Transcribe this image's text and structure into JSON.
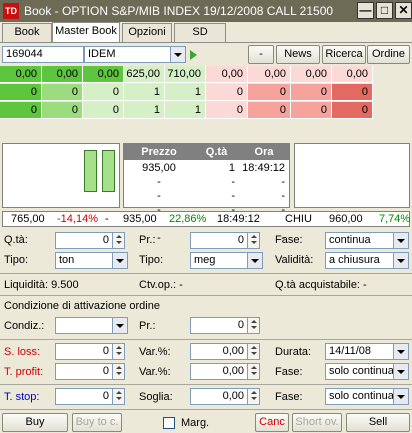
{
  "window": {
    "logo_text": "TD",
    "title": "Book - OPTION S&P/MIB INDEX 19/12/2008 CALL 21500",
    "min_glyph": "—",
    "max_glyph": "□",
    "close_glyph": "✕"
  },
  "tabs": [
    {
      "label": "Book",
      "active": false
    },
    {
      "label": "Master Book",
      "active": true
    },
    {
      "label": "Opzioni",
      "active": false
    },
    {
      "label": "SD",
      "active": false
    }
  ],
  "toolbar": {
    "symbol": "169044",
    "market": "IDEM",
    "minus_label": "-",
    "news_label": "News",
    "ricerca_label": "Ricerca",
    "ordine_label": "Ordine"
  },
  "levels": {
    "row1": [
      "0,00",
      "0,00",
      "0,00",
      "625,00",
      "710,00",
      "0,00",
      "0,00",
      "0,00",
      "0,00"
    ],
    "row2": [
      "0",
      "0",
      "0",
      "1",
      "1",
      "0",
      "0",
      "0",
      "0"
    ],
    "row3": [
      "0",
      "0",
      "0",
      "1",
      "1",
      "0",
      "0",
      "0",
      "0"
    ]
  },
  "book": {
    "headers": [
      "Prezzo",
      "Q.tà",
      "Ora"
    ],
    "rows": [
      [
        "935,00",
        "1",
        "18:49:12"
      ],
      [
        "-",
        "-",
        "-"
      ],
      [
        "-",
        "-",
        "-"
      ],
      [
        "-",
        "-",
        "-"
      ],
      [
        "-",
        "-",
        "-"
      ],
      [
        "-",
        "-",
        "-"
      ]
    ]
  },
  "summary": {
    "low": "765,00",
    "low_pct": "-14,14%",
    "dash": "-",
    "last": "935,00",
    "last_pct": "22,86%",
    "time": "18:49:12",
    "status": "CHIU",
    "high": "960,00",
    "high_pct": "7,74%"
  },
  "order": {
    "qta_label": "Q.tà:",
    "qta_value": "0",
    "pr_label": "Pr.:",
    "pr_value": "0",
    "fase_label": "Fase:",
    "fase_value": "continua",
    "tipo_label": "Tipo:",
    "tipo_value": "ton",
    "tipo2_label": "Tipo:",
    "tipo2_value": "meg",
    "validita_label": "Validità:",
    "validita_value": "a chiusura",
    "liquidita": "Liquidità: 9.500",
    "ctv": "Ctv.op.: -",
    "qta_acq": "Q.tà acquistabile: -"
  },
  "condition": {
    "title": "Condizione di attivazione ordine",
    "condiz_label": "Condiz.:",
    "condiz_value": "",
    "pr_label": "Pr.:",
    "pr_value": "0"
  },
  "stops": {
    "sloss_label": "S. loss:",
    "sloss_value": "0",
    "varpct1_label": "Var.%:",
    "varpct1_value": "0,00",
    "durata_label": "Durata:",
    "durata_value": "14/11/08",
    "tprofit_label": "T. profit:",
    "tprofit_value": "0",
    "varpct2_label": "Var.%:",
    "varpct2_value": "0,00",
    "fase2_label": "Fase:",
    "fase2_value": "solo continua",
    "tstop_label": "T. stop:",
    "tstop_value": "0",
    "soglia_label": "Soglia:",
    "soglia_value": "0,00",
    "fase3_label": "Fase:",
    "fase3_value": "solo continua"
  },
  "actions": {
    "buy": "Buy",
    "buy_to_c": "Buy to c.",
    "marg": "Marg.",
    "canc": "Canc",
    "short_ov": "Short ov.",
    "sell": "Sell"
  },
  "colors": {
    "bid_dark": "#5ec53f",
    "bid_mid": "#9bdc7e",
    "bid_light": "#d5f0c7",
    "ask_light": "#fbd9d6",
    "ask_mid": "#f5a39c",
    "ask_dark": "#e36a62",
    "negative": "#cc0000",
    "positive": "#008800"
  }
}
